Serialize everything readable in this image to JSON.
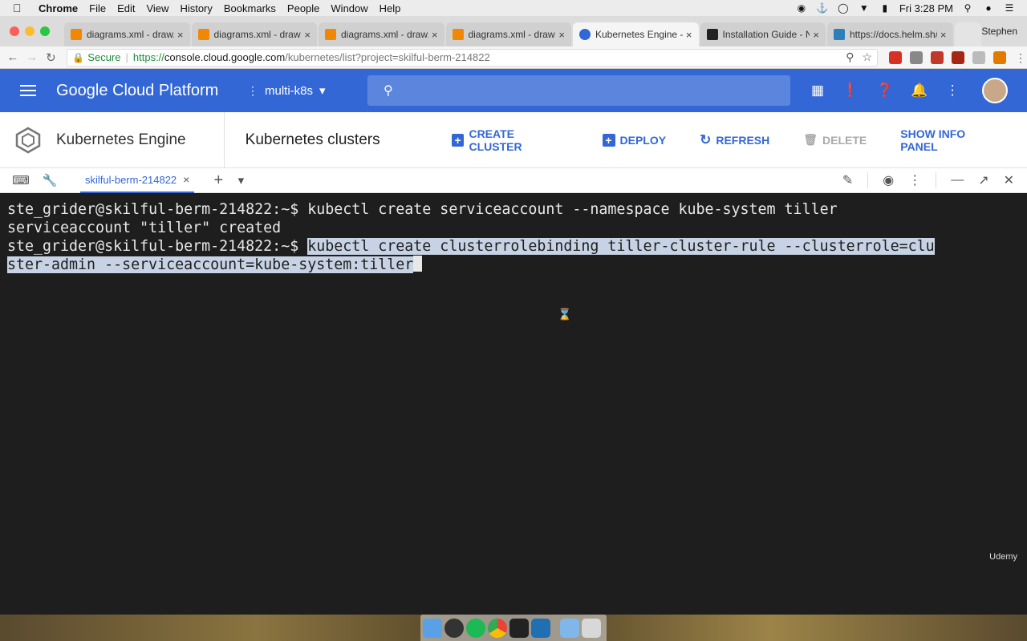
{
  "menubar": {
    "app": "Chrome",
    "items": [
      "File",
      "Edit",
      "View",
      "History",
      "Bookmarks",
      "People",
      "Window",
      "Help"
    ],
    "clock": "Fri 3:28 PM"
  },
  "tabs": [
    {
      "title": "diagrams.xml - draw.io",
      "favicon_color": "#f08705"
    },
    {
      "title": "diagrams.xml - draw.io",
      "favicon_color": "#f08705"
    },
    {
      "title": "diagrams.xml - draw.io",
      "favicon_color": "#f08705"
    },
    {
      "title": "diagrams.xml - draw.io",
      "favicon_color": "#f08705"
    },
    {
      "title": "Kubernetes Engine - m",
      "favicon_color": "#3367d6"
    },
    {
      "title": "Installation Guide - NG",
      "favicon_color": "#222222"
    },
    {
      "title": "https://docs.helm.sh/u",
      "favicon_color": "#2c7fb8"
    }
  ],
  "profile_name": "Stephen",
  "address": {
    "secure_label": "Secure",
    "scheme": "https://",
    "host": "console.cloud.google.com",
    "path": "/kubernetes/list?project=skilful-berm-214822"
  },
  "gcp": {
    "title": "Google Cloud Platform",
    "project": "multi-k8s"
  },
  "subheader": {
    "product": "Kubernetes Engine",
    "page_title": "Kubernetes clusters",
    "actions": {
      "create": "CREATE CLUSTER",
      "deploy": "DEPLOY",
      "refresh": "REFRESH",
      "delete": "DELETE",
      "info": "SHOW INFO PANEL"
    }
  },
  "shell": {
    "tab_label": "skilful-berm-214822"
  },
  "terminal": {
    "line1_prompt": "ste_grider@skilful-berm-214822:~$ ",
    "line1_cmd": "kubectl create serviceaccount --namespace kube-system tiller",
    "line2": "serviceaccount \"tiller\" created",
    "line3_prompt": "ste_grider@skilful-berm-214822:~$ ",
    "line3_cmd_a": "kubectl create clusterrolebinding tiller-cluster-rule --clusterrole=clu",
    "line3_cmd_b": "ster-admin --serviceaccount=kube-system:tiller"
  },
  "watermark": "Udemy",
  "colors": {
    "gcp_blue": "#3367d6",
    "terminal_bg": "#1e1e1e",
    "selection": "#c7d3e4"
  }
}
